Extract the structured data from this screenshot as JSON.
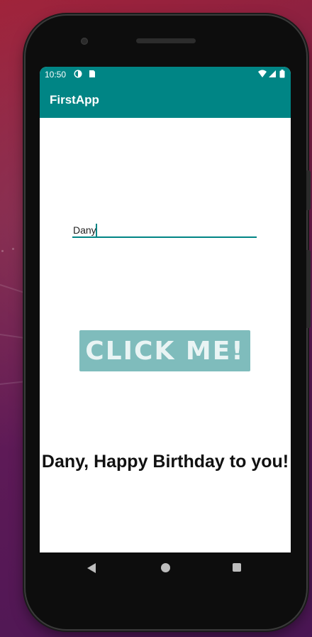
{
  "status_bar": {
    "time": "10:50",
    "icons": [
      "app-notification-icon",
      "sd-card-icon",
      "wifi-icon",
      "signal-icon",
      "battery-icon"
    ]
  },
  "app_bar": {
    "title": "FirstApp"
  },
  "name_input": {
    "value": "Dany"
  },
  "action_button": {
    "label": "CLICK ME!"
  },
  "greeting": {
    "text": "Dany, Happy Birthday to you!"
  },
  "nav_bar": {
    "icons": [
      "back-icon",
      "home-icon",
      "recents-icon"
    ]
  },
  "colors": {
    "primary": "#008585",
    "button": "#7fbcbc",
    "screen_background": "#ffffff",
    "wallpaper": "#6a1c4e"
  }
}
